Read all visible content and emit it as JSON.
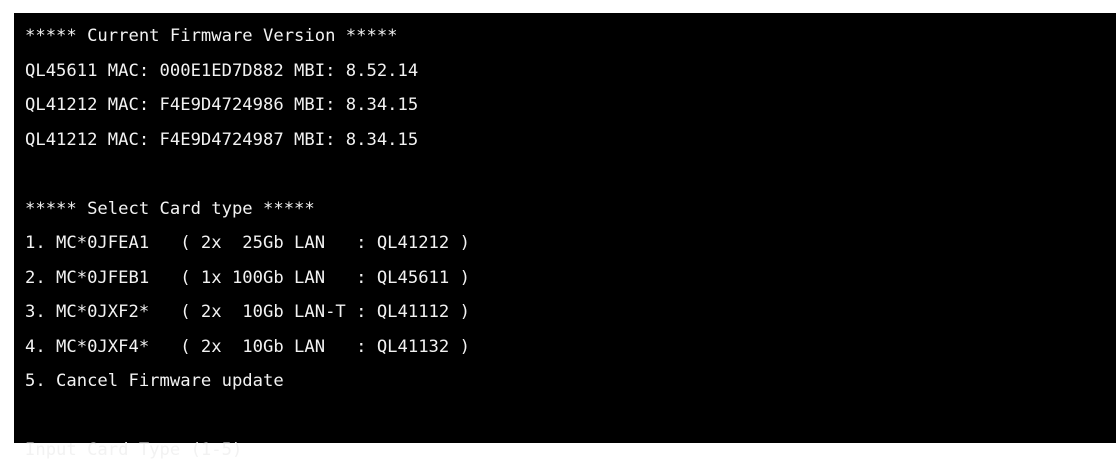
{
  "terminal": {
    "current_fw_header": "***** Current Firmware Version *****",
    "firmware_list": [
      "QL45611 MAC: 000E1ED7D882 MBI: 8.52.14",
      "QL41212 MAC: F4E9D4724986 MBI: 8.34.15",
      "QL41212 MAC: F4E9D4724987 MBI: 8.34.15"
    ],
    "select_header": "***** Select Card type *****",
    "options": [
      "1. MC*0JFEA1   ( 2x  25Gb LAN   : QL41212 )",
      "2. MC*0JFEB1   ( 1x 100Gb LAN   : QL45611 )",
      "3. MC*0JXF2*   ( 2x  10Gb LAN-T : QL41112 )",
      "4. MC*0JXF4*   ( 2x  10Gb LAN   : QL41132 )",
      "5. Cancel Firmware update"
    ],
    "prompt": "Input Card Type (1-5)"
  }
}
